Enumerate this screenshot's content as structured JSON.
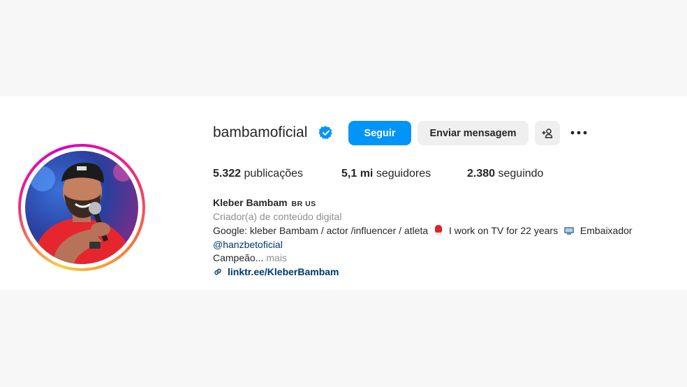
{
  "profile": {
    "username": "bambamoficial",
    "buttons": {
      "follow": "Seguir",
      "message": "Enviar mensagem"
    },
    "stats": {
      "posts_count": "5.322",
      "posts_label": "publicações",
      "followers_count": "5,1 mi",
      "followers_label": "seguidores",
      "following_count": "2.380",
      "following_label": "seguindo"
    },
    "full_name": "Kleber Bambam",
    "name_flags": "BR US",
    "category": "Criador(a) de conteúdo digital",
    "bio": {
      "part1": "Google: kleber Bambam / actor /influencer / atleta",
      "part2": "I work on TV for 22 years",
      "part3": "Embaixador",
      "mention": "@hanzbetoficial",
      "line2": "Campeão...",
      "more": "mais"
    },
    "link": "linktr.ee/KleberBambam"
  },
  "icons": [
    "verified-icon",
    "add-user-icon",
    "more-options-icon",
    "boxing-glove-icon",
    "tv-icon",
    "link-icon"
  ],
  "colors": {
    "accent": "#0095f6",
    "secondary_button": "#efefef",
    "link_text": "#00376b",
    "muted_text": "#8e8e8e",
    "verified": "#0095f6"
  }
}
